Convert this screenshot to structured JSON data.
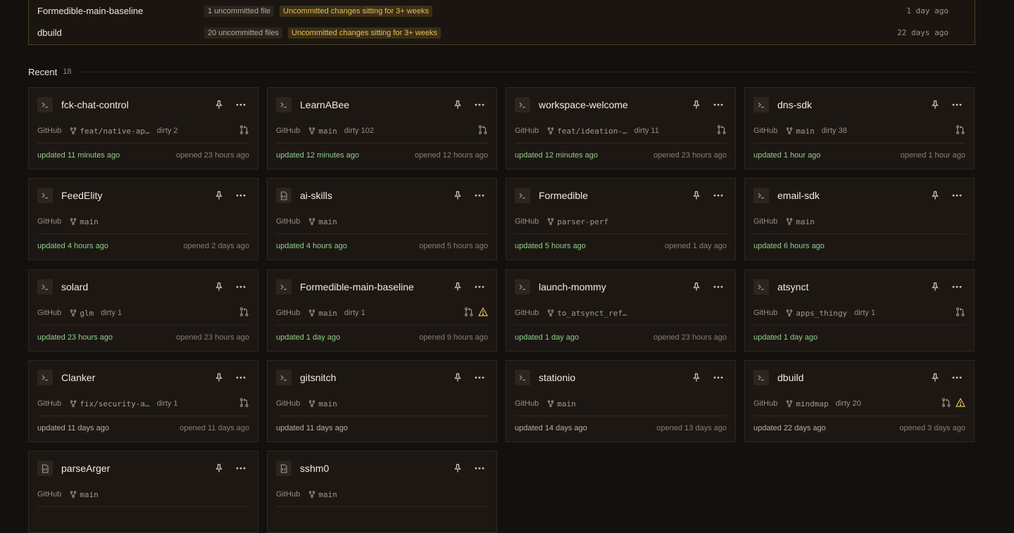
{
  "stale_panel": {
    "rows": [
      {
        "name": "Formedible-main-baseline",
        "files": "1 uncommitted file",
        "warning": "Uncommitted changes sitting for 3+ weeks",
        "ago": "1 day ago"
      },
      {
        "name": "dbuild",
        "files": "20 uncommitted files",
        "warning": "Uncommitted changes sitting for 3+ weeks",
        "ago": "22 days ago"
      }
    ]
  },
  "recent": {
    "title": "Recent",
    "count": "18"
  },
  "cards": [
    {
      "title": "fck-chat-control",
      "icon": "terminal-icon",
      "source": "GitHub",
      "branch": "feat/native-ap…",
      "dirty": "dirty 2",
      "git_icon": true,
      "warn_icon": false,
      "updated": "updated 11 minutes ago",
      "updated_recent": true,
      "opened": "opened 23 hours ago"
    },
    {
      "title": "LearnABee",
      "icon": "terminal-icon",
      "source": "GitHub",
      "branch": "main",
      "dirty": "dirty 102",
      "git_icon": true,
      "warn_icon": false,
      "updated": "updated 12 minutes ago",
      "updated_recent": true,
      "opened": "opened 12 hours ago"
    },
    {
      "title": "workspace-welcome",
      "icon": "terminal-icon",
      "source": "GitHub",
      "branch": "feat/ideation-…",
      "dirty": "dirty 11",
      "git_icon": true,
      "warn_icon": false,
      "updated": "updated 12 minutes ago",
      "updated_recent": true,
      "opened": "opened 23 hours ago"
    },
    {
      "title": "dns-sdk",
      "icon": "terminal-icon",
      "source": "GitHub",
      "branch": "main",
      "dirty": "dirty 38",
      "git_icon": true,
      "warn_icon": false,
      "updated": "updated 1 hour ago",
      "updated_recent": true,
      "opened": "opened 1 hour ago"
    },
    {
      "title": "FeedElity",
      "icon": "terminal-icon",
      "source": "GitHub",
      "branch": "main",
      "dirty": "",
      "git_icon": false,
      "warn_icon": false,
      "updated": "updated 4 hours ago",
      "updated_recent": true,
      "opened": "opened 2 days ago"
    },
    {
      "title": "ai-skills",
      "icon": "file-code-icon",
      "source": "GitHub",
      "branch": "main",
      "dirty": "",
      "git_icon": false,
      "warn_icon": false,
      "updated": "updated 4 hours ago",
      "updated_recent": true,
      "opened": "opened 5 hours ago"
    },
    {
      "title": "Formedible",
      "icon": "terminal-icon",
      "source": "GitHub",
      "branch": "parser-perf",
      "dirty": "",
      "git_icon": false,
      "warn_icon": false,
      "updated": "updated 5 hours ago",
      "updated_recent": true,
      "opened": "opened 1 day ago"
    },
    {
      "title": "email-sdk",
      "icon": "terminal-icon",
      "source": "GitHub",
      "branch": "main",
      "dirty": "",
      "git_icon": false,
      "warn_icon": false,
      "updated": "updated 6 hours ago",
      "updated_recent": true,
      "opened": ""
    },
    {
      "title": "solard",
      "icon": "terminal-icon",
      "source": "GitHub",
      "branch": "glm",
      "dirty": "dirty 1",
      "git_icon": true,
      "warn_icon": false,
      "updated": "updated 23 hours ago",
      "updated_recent": true,
      "opened": "opened 23 hours ago"
    },
    {
      "title": "Formedible-main-baseline",
      "icon": "terminal-icon",
      "source": "GitHub",
      "branch": "main",
      "dirty": "dirty 1",
      "git_icon": true,
      "warn_icon": true,
      "updated": "updated 1 day ago",
      "updated_recent": true,
      "opened": "opened 9 hours ago"
    },
    {
      "title": "launch-mommy",
      "icon": "terminal-icon",
      "source": "GitHub",
      "branch": "to_atsynct_ref…",
      "dirty": "",
      "git_icon": false,
      "warn_icon": false,
      "updated": "updated 1 day ago",
      "updated_recent": true,
      "opened": "opened 23 hours ago"
    },
    {
      "title": "atsynct",
      "icon": "terminal-icon",
      "source": "GitHub",
      "branch": "apps_thingy",
      "dirty": "dirty 1",
      "git_icon": true,
      "warn_icon": false,
      "updated": "updated 1 day ago",
      "updated_recent": true,
      "opened": ""
    },
    {
      "title": "Clanker",
      "icon": "terminal-icon",
      "source": "GitHub",
      "branch": "fix/security-a…",
      "dirty": "dirty 1",
      "git_icon": true,
      "warn_icon": false,
      "updated": "updated 11 days ago",
      "updated_recent": false,
      "opened": "opened 11 days ago"
    },
    {
      "title": "gitsnitch",
      "icon": "terminal-icon",
      "source": "GitHub",
      "branch": "main",
      "dirty": "",
      "git_icon": false,
      "warn_icon": false,
      "updated": "updated 11 days ago",
      "updated_recent": false,
      "opened": ""
    },
    {
      "title": "stationio",
      "icon": "terminal-icon",
      "source": "GitHub",
      "branch": "main",
      "dirty": "",
      "git_icon": false,
      "warn_icon": false,
      "updated": "updated 14 days ago",
      "updated_recent": false,
      "opened": "opened 13 days ago"
    },
    {
      "title": "dbuild",
      "icon": "terminal-icon",
      "source": "GitHub",
      "branch": "mindmap",
      "dirty": "dirty 20",
      "git_icon": true,
      "warn_icon": true,
      "updated": "updated 22 days ago",
      "updated_recent": false,
      "opened": "opened 3 days ago"
    },
    {
      "title": "parseArger",
      "icon": "file-code-icon",
      "source": "GitHub",
      "branch": "main",
      "dirty": "",
      "git_icon": false,
      "warn_icon": false,
      "updated": "",
      "updated_recent": false,
      "opened": ""
    },
    {
      "title": "sshm0",
      "icon": "file-code-icon",
      "source": "GitHub",
      "branch": "main",
      "dirty": "",
      "git_icon": false,
      "warn_icon": false,
      "updated": "",
      "updated_recent": false,
      "opened": ""
    }
  ]
}
